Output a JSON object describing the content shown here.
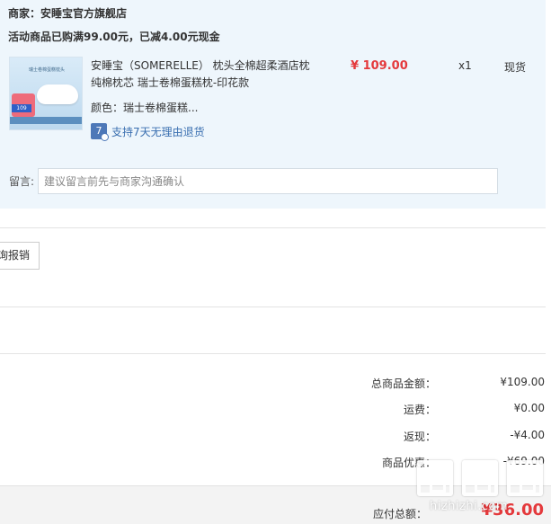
{
  "store": {
    "name": "商家：安睡宝官方旗舰店",
    "promo": "活动商品已购满99.00元，已减4.00元现金"
  },
  "item": {
    "thumb_caption": "瑞士卷棉蛋糕枕头",
    "thumb_price": "109",
    "title": "安睡宝（SOMERELLE） 枕头全棉超柔酒店枕纯棉枕芯 瑞士卷棉蛋糕枕-印花款",
    "price": "¥ 109.00",
    "qty": "x1",
    "stock": "现货",
    "color": "颜色：瑞士卷棉蛋糕...",
    "return_icon": "7",
    "return_text": "支持7天无理由退货"
  },
  "message": {
    "label": "留言:",
    "placeholder": "建议留言前先与商家沟通确认"
  },
  "invoice": {
    "button_label": "询报销"
  },
  "summary": {
    "rows": [
      {
        "label": "总商品金额：",
        "value": "¥109.00"
      },
      {
        "label": "运费：",
        "value": "¥0.00"
      },
      {
        "label": "返现：",
        "value": "-¥4.00"
      },
      {
        "label": "商品优惠：",
        "value": "-¥69.00"
      }
    ],
    "payable_label": "应付总额：",
    "payable_value": "¥36.00"
  },
  "watermark": {
    "site": "hizhizhi.com"
  },
  "colors": {
    "accent_red": "#e4393c",
    "panel_bg": "#eef6fc",
    "link_blue": "#3a6fb0"
  }
}
